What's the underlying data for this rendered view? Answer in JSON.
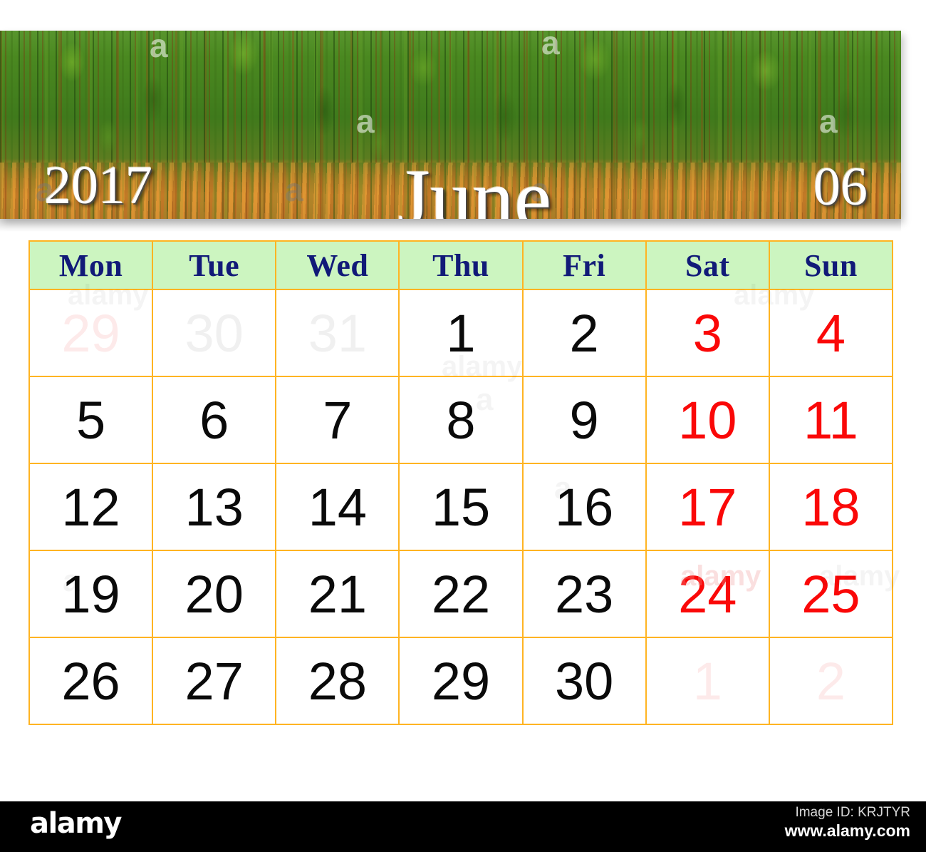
{
  "header": {
    "year": "2017",
    "month_name": "June",
    "month_number": "06",
    "photo_alt": "pine-forest-sandy-bank-photo"
  },
  "calendar": {
    "weekday_headers": [
      "Mon",
      "Tue",
      "Wed",
      "Thu",
      "Fri",
      "Sat",
      "Sun"
    ],
    "weeks": [
      [
        {
          "day": "29",
          "type": "other-weekend"
        },
        {
          "day": "30",
          "type": "other"
        },
        {
          "day": "31",
          "type": "other"
        },
        {
          "day": "1",
          "type": "normal"
        },
        {
          "day": "2",
          "type": "normal"
        },
        {
          "day": "3",
          "type": "weekend"
        },
        {
          "day": "4",
          "type": "weekend"
        }
      ],
      [
        {
          "day": "5",
          "type": "normal"
        },
        {
          "day": "6",
          "type": "normal"
        },
        {
          "day": "7",
          "type": "normal"
        },
        {
          "day": "8",
          "type": "normal"
        },
        {
          "day": "9",
          "type": "normal"
        },
        {
          "day": "10",
          "type": "weekend"
        },
        {
          "day": "11",
          "type": "weekend"
        }
      ],
      [
        {
          "day": "12",
          "type": "normal"
        },
        {
          "day": "13",
          "type": "normal"
        },
        {
          "day": "14",
          "type": "normal"
        },
        {
          "day": "15",
          "type": "normal"
        },
        {
          "day": "16",
          "type": "normal"
        },
        {
          "day": "17",
          "type": "weekend"
        },
        {
          "day": "18",
          "type": "weekend"
        }
      ],
      [
        {
          "day": "19",
          "type": "normal"
        },
        {
          "day": "20",
          "type": "normal"
        },
        {
          "day": "21",
          "type": "normal"
        },
        {
          "day": "22",
          "type": "normal"
        },
        {
          "day": "23",
          "type": "normal"
        },
        {
          "day": "24",
          "type": "weekend"
        },
        {
          "day": "25",
          "type": "weekend"
        }
      ],
      [
        {
          "day": "26",
          "type": "normal"
        },
        {
          "day": "27",
          "type": "normal"
        },
        {
          "day": "28",
          "type": "normal"
        },
        {
          "day": "29",
          "type": "normal"
        },
        {
          "day": "30",
          "type": "normal"
        },
        {
          "day": "1",
          "type": "other-weekend"
        },
        {
          "day": "2",
          "type": "other-weekend"
        }
      ]
    ]
  },
  "colors": {
    "grid_border": "#ffb422",
    "weekday_header_bg": "#ccf5c0",
    "weekday_header_text": "#111a78",
    "weekend_day": "#fa0808",
    "normal_day": "#0a0a0a",
    "other_month_day": "#f0f0f0",
    "other_month_weekend_day": "#fdeaea",
    "title_text": "#ffffff",
    "footer_bar": "#000000"
  },
  "watermarks": {
    "brand": "alamy",
    "letter": "a",
    "positions_note": "repeated tiled watermark over photo and grid"
  },
  "footer": {
    "logo": "alamy",
    "image_id": "Image ID: KRJTYR",
    "url": "www.alamy.com"
  }
}
